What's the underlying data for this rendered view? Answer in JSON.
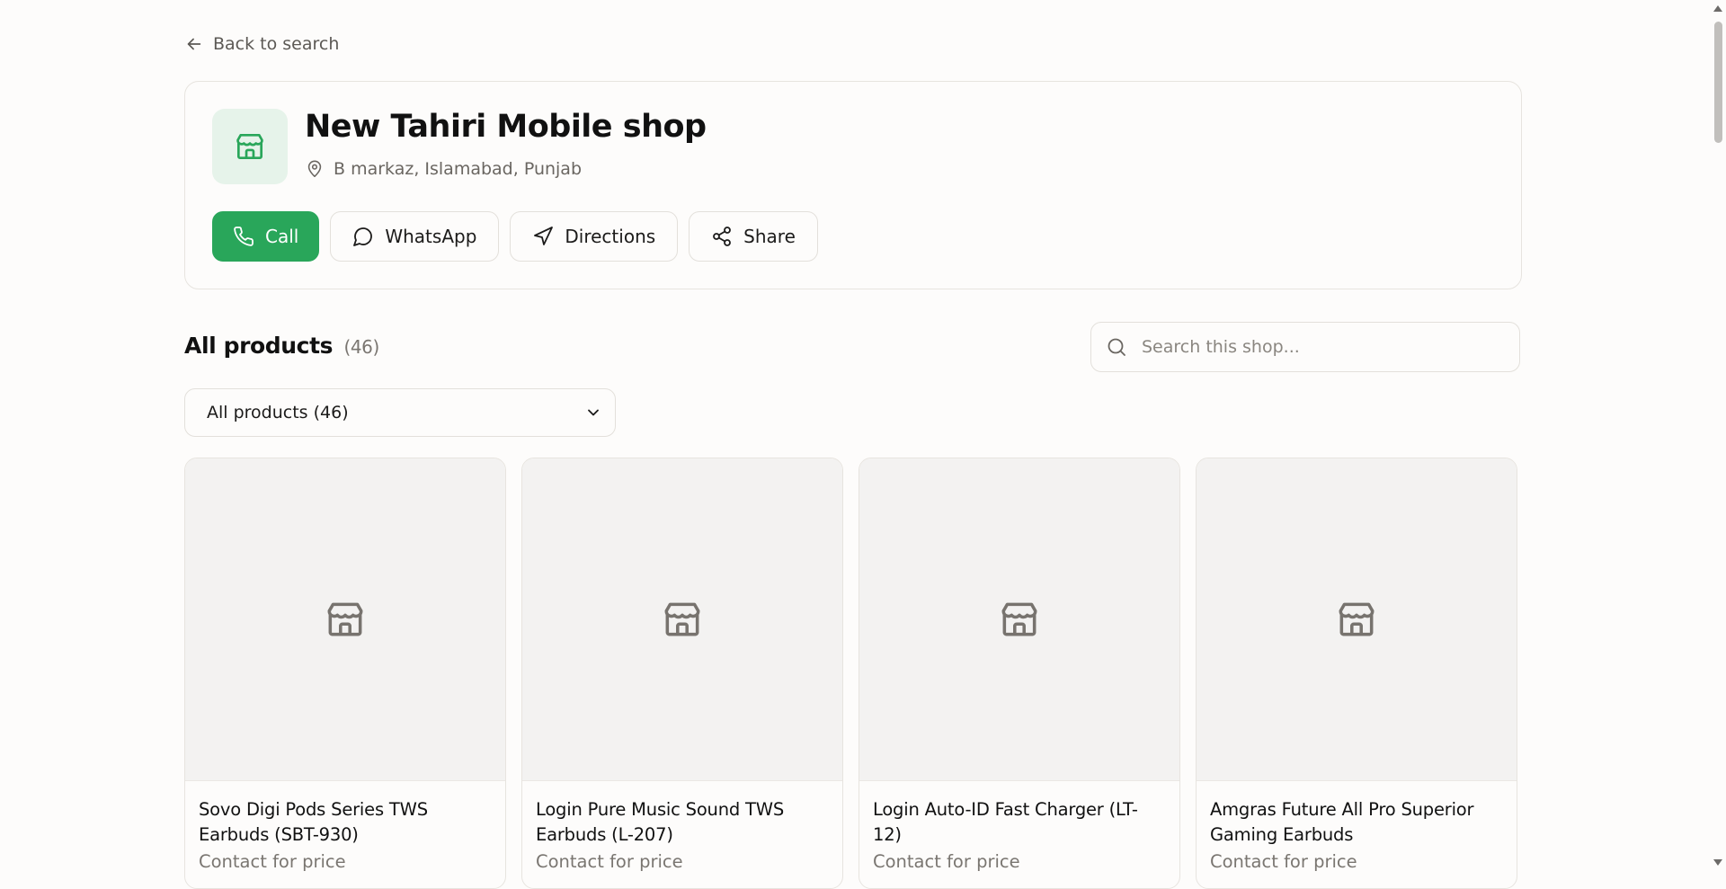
{
  "nav": {
    "back_label": "Back to search"
  },
  "shop": {
    "name": "New Tahiri Mobile shop",
    "location": "B markaz, Islamabad, Punjab",
    "actions": {
      "call": "Call",
      "whatsapp": "WhatsApp",
      "directions": "Directions",
      "share": "Share"
    }
  },
  "products_section": {
    "title": "All products",
    "count": "(46)",
    "search_placeholder": "Search this shop...",
    "category_selected": "All products (46)"
  },
  "products": [
    {
      "name": "Sovo Digi Pods Series TWS Earbuds (SBT-930)",
      "price": "Contact for price"
    },
    {
      "name": "Login Pure Music Sound TWS Earbuds (L-207)",
      "price": "Contact for price"
    },
    {
      "name": "Login Auto-ID Fast Charger (LT-12)",
      "price": "Contact for price"
    },
    {
      "name": "Amgras Future All Pro Superior Gaming Earbuds",
      "price": "Contact for price"
    }
  ],
  "colors": {
    "accent": "#29a65a",
    "accent_light": "#e6f3ea",
    "background": "#fdfcfb",
    "border": "#e3e0db",
    "muted_text": "#7a7671"
  },
  "icons": {
    "back": "arrow-left-icon",
    "shop_logo": "store-icon",
    "location": "map-pin-icon",
    "call": "phone-icon",
    "whatsapp": "message-circle-icon",
    "directions": "navigation-icon",
    "share": "share-icon",
    "search": "search-icon",
    "dropdown": "chevron-down-icon",
    "product_placeholder": "store-icon"
  }
}
